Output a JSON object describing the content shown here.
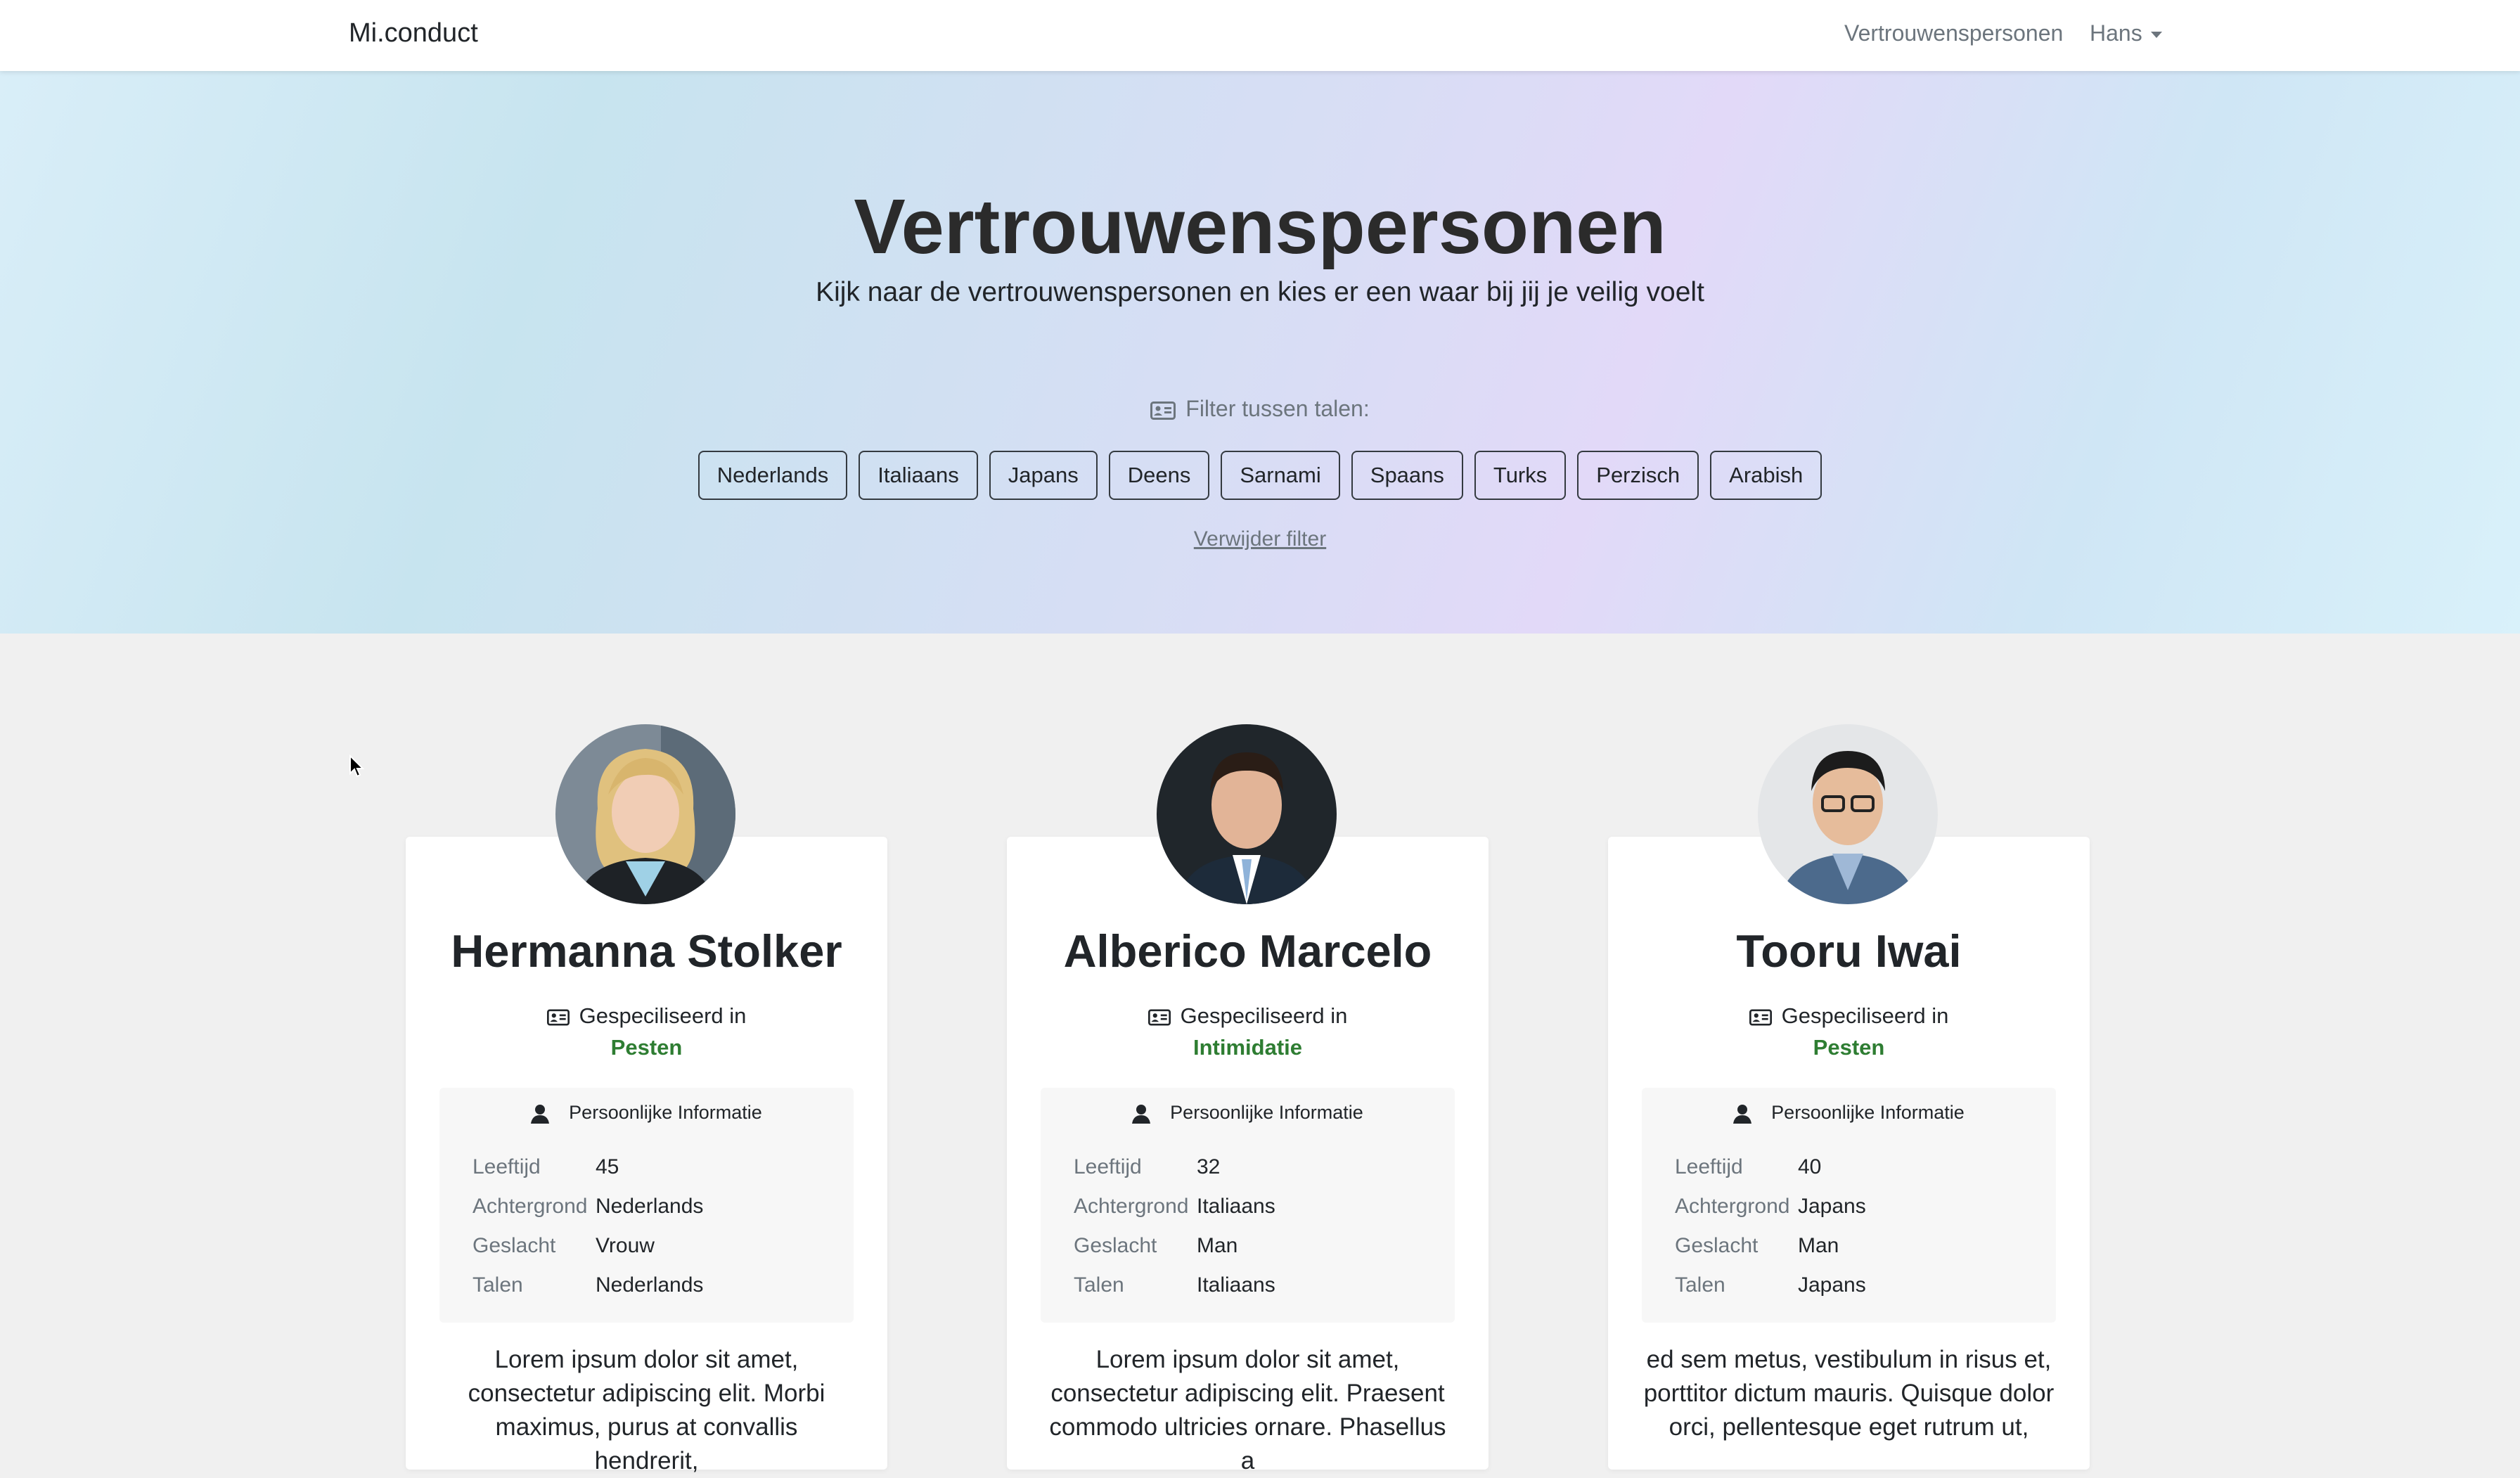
{
  "navbar": {
    "brand": "Mi.conduct",
    "link": "Vertrouwenspersonen",
    "user": "Hans"
  },
  "hero": {
    "title": "Vertrouwenspersonen",
    "subtitle": "Kijk naar de vertrouwenspersonen en kies er een waar bij jij je veilig voelt",
    "filter_label": "Filter tussen talen:",
    "languages": [
      "Nederlands",
      "Italiaans",
      "Japans",
      "Deens",
      "Sarnami",
      "Spaans",
      "Turks",
      "Perzisch",
      "Arabish"
    ],
    "remove_filter": "Verwijder filter"
  },
  "labels": {
    "specialized": "Gespeciliseerd in",
    "personal_info": "Persoonlijke Informatie",
    "age": "Leeftijd",
    "background": "Achtergrond",
    "gender": "Geslacht",
    "languages": "Talen"
  },
  "persons": [
    {
      "name": "Hermanna Stolker",
      "specialty": "Pesten",
      "age": "45",
      "background": "Nederlands",
      "gender": "Vrouw",
      "languages": "Nederlands",
      "desc1": "Lorem ipsum dolor sit amet,",
      "desc2": "consectetur adipiscing elit. Morbi",
      "desc3": "maximus, purus at convallis hendrerit,"
    },
    {
      "name": "Alberico Marcelo",
      "specialty": "Intimidatie",
      "age": "32",
      "background": "Italiaans",
      "gender": "Man",
      "languages": "Italiaans",
      "desc1": "Lorem ipsum dolor sit amet,",
      "desc2": "consectetur adipiscing elit. Praesent",
      "desc3": "commodo ultricies ornare. Phasellus a"
    },
    {
      "name": "Tooru Iwai",
      "specialty": "Pesten",
      "age": "40",
      "background": "Japans",
      "gender": "Man",
      "languages": "Japans",
      "desc1": "ed sem metus, vestibulum in risus et,",
      "desc2": "porttitor dictum mauris. Quisque dolor",
      "desc3": "orci, pellentesque eget rutrum ut,"
    }
  ],
  "colors": {
    "specialty": "#2e7d32",
    "muted": "#6c757d"
  }
}
